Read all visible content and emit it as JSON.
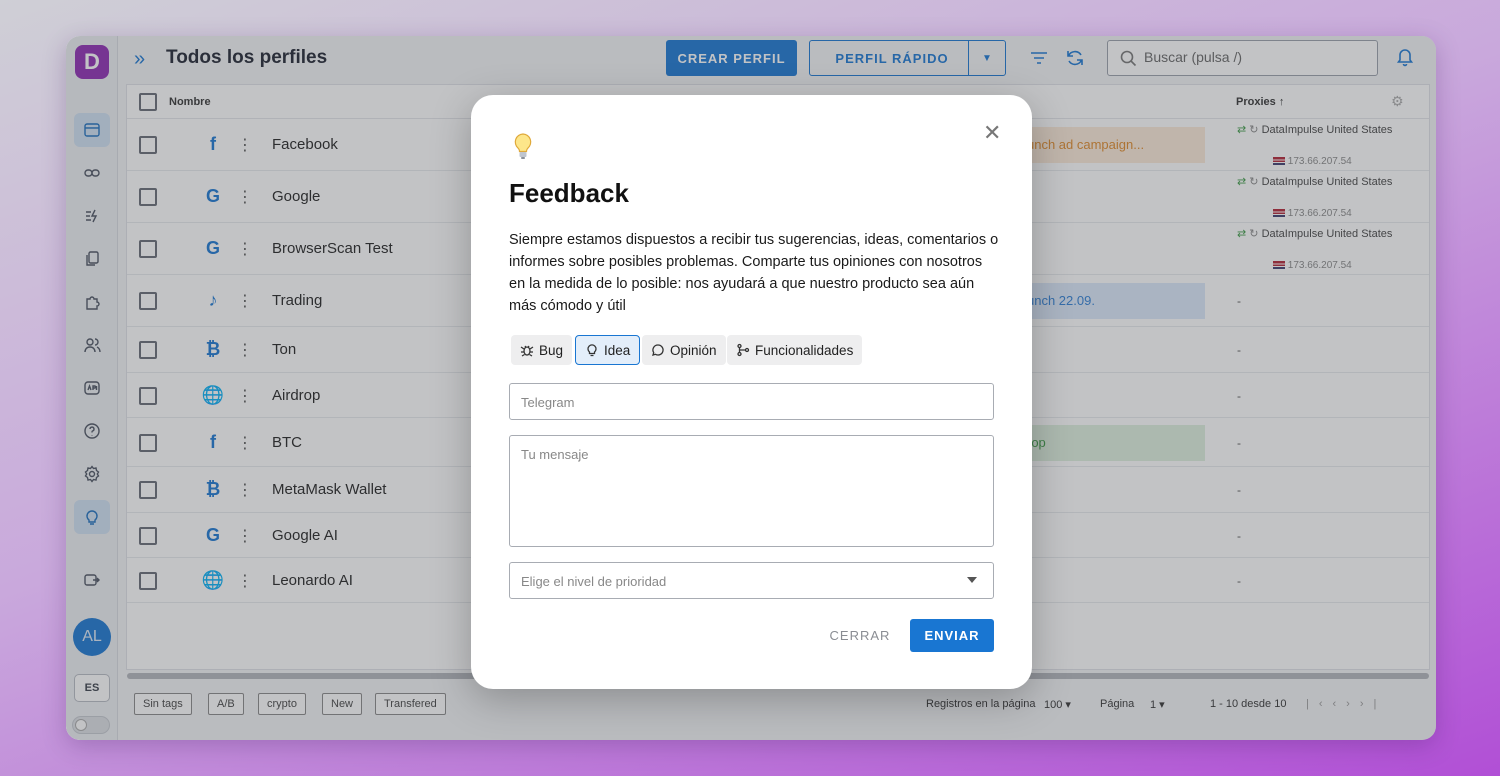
{
  "app": {
    "logo_letter": "D",
    "avatar_initials": "AL",
    "language": "ES"
  },
  "header": {
    "title": "Todos los perfiles",
    "create_profile": "CREAR PERFIL",
    "quick_profile": "PERFIL RÁPIDO",
    "search_placeholder": "Buscar (pulsa /)"
  },
  "table": {
    "columns": {
      "name": "Nombre",
      "proxies": "Proxies"
    },
    "rows": [
      {
        "name": "Facebook",
        "site_icon": "facebook-icon",
        "site_glyph": "f",
        "note": "unch ad campaign...",
        "proxy": "DataImpulse United States",
        "ip": "173.66.207.54"
      },
      {
        "name": "Google",
        "site_icon": "google-icon",
        "site_glyph": "G",
        "note": "",
        "proxy": "DataImpulse United States",
        "ip": "173.66.207.54"
      },
      {
        "name": "BrowserScan Test",
        "site_icon": "google-icon",
        "site_glyph": "G",
        "note": "",
        "proxy": "DataImpulse United States",
        "ip": "173.66.207.54"
      },
      {
        "name": "Trading",
        "site_icon": "tiktok-icon",
        "site_glyph": "♪",
        "note": "unch 22.09.",
        "proxy": "-",
        "ip": ""
      },
      {
        "name": "Ton",
        "site_icon": "bitcoin-icon",
        "site_glyph": "₿",
        "note": "",
        "proxy": "-",
        "ip": ""
      },
      {
        "name": "Airdrop",
        "site_icon": "globe-icon",
        "site_glyph": "🌐",
        "note": "",
        "proxy": "-",
        "ip": ""
      },
      {
        "name": "BTC",
        "site_icon": "facebook-icon",
        "site_glyph": "f",
        "note": "rop",
        "proxy": "-",
        "ip": ""
      },
      {
        "name": "MetaMask Wallet",
        "site_icon": "bitcoin-icon",
        "site_glyph": "₿",
        "note": "",
        "proxy": "-",
        "ip": ""
      },
      {
        "name": "Google AI",
        "site_icon": "google-icon",
        "site_glyph": "G",
        "note": "",
        "proxy": "-",
        "ip": ""
      },
      {
        "name": "Leonardo AI",
        "site_icon": "globe-icon",
        "site_glyph": "🌐",
        "note": "",
        "proxy": "-",
        "ip": ""
      }
    ]
  },
  "footer": {
    "tags": [
      "Sin tags",
      "A/B",
      "crypto",
      "New",
      "Transfered"
    ],
    "rows_per_page_label": "Registros en la página",
    "rows_per_page": "100",
    "page_label": "Página",
    "page": "1",
    "range": "1 - 10 desde 10"
  },
  "modal": {
    "title": "Feedback",
    "description": "Siempre estamos dispuestos a recibir tus sugerencias, ideas, comentarios o informes sobre posibles problemas. Comparte tus opiniones con nosotros en la medida de lo posible: nos ayudará a que nuestro producto sea aún más cómodo y útil",
    "categories": [
      {
        "label": "Bug",
        "icon": "bug-icon",
        "selected": false
      },
      {
        "label": "Idea",
        "icon": "lightbulb-icon",
        "selected": true
      },
      {
        "label": "Opinión",
        "icon": "speech-bubble-icon",
        "selected": false
      },
      {
        "label": "Funcionalidades",
        "icon": "git-branch-icon",
        "selected": false
      }
    ],
    "telegram_placeholder": "Telegram",
    "message_placeholder": "Tu mensaje",
    "priority_placeholder": "Elige el nivel de prioridad",
    "close_label": "CERRAR",
    "send_label": "ENVIAR"
  },
  "colors": {
    "accent": "#1976d2",
    "brand": "#8e2bb3",
    "note_orange_bg": "#fdebd8",
    "note_orange_text": "#e08a2a",
    "note_blue_bg": "#dbe9fb",
    "note_blue_text": "#2f7fd6",
    "note_green_bg": "#dff1de",
    "note_green_text": "#3c9a45"
  }
}
